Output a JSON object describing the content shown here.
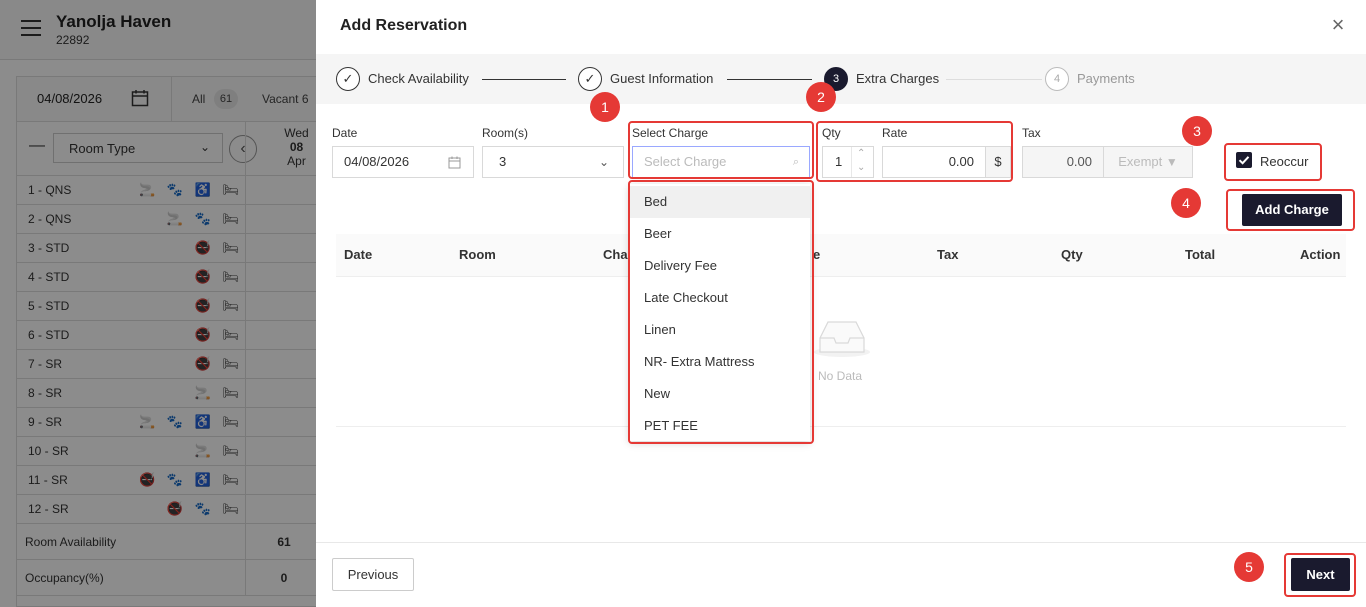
{
  "background": {
    "property_name": "Yanolja Haven",
    "property_id": "22892",
    "date": "04/08/2026",
    "filter_all": "All",
    "filter_all_count": "61",
    "filter_vacant": "Vacant",
    "filter_vacant_count": "6",
    "room_type_label": "Room Type",
    "day": {
      "weekday": "Wed",
      "date": "08",
      "month": "Apr"
    },
    "rooms": [
      {
        "name": "1 - QNS",
        "icons": "🚬 🐾 ♿ 🛏"
      },
      {
        "name": "2 - QNS",
        "icons": "🚬 🐾 🛏"
      },
      {
        "name": "3 - STD",
        "icons": "🚭 🛏"
      },
      {
        "name": "4 - STD",
        "icons": "🚭 🛏"
      },
      {
        "name": "5 - STD",
        "icons": "🚭 🛏"
      },
      {
        "name": "6 - STD",
        "icons": "🚭 🛏"
      },
      {
        "name": "7 - SR",
        "icons": "🚭 🛏"
      },
      {
        "name": "8 - SR",
        "icons": "🚬 🛏"
      },
      {
        "name": "9 - SR",
        "icons": "🚬 🐾 ♿ 🛏"
      },
      {
        "name": "10 - SR",
        "icons": "🚬 🛏"
      },
      {
        "name": "11 - SR",
        "icons": "🚭 🐾 ♿ 🛏"
      },
      {
        "name": "12 - SR",
        "icons": "🚭 🐾 🛏"
      }
    ],
    "room_availability_label": "Room Availability",
    "room_availability_value": "61",
    "occupancy_label": "Occupancy(%)",
    "occupancy_value": "0"
  },
  "drawer": {
    "title": "Add Reservation",
    "steps": [
      {
        "label": "Check Availability",
        "marker": "✓",
        "state": "done"
      },
      {
        "label": "Guest Information",
        "marker": "✓",
        "state": "done"
      },
      {
        "label": "Extra Charges",
        "marker": "3",
        "state": "active"
      },
      {
        "label": "Payments",
        "marker": "4",
        "state": "pending"
      }
    ],
    "form": {
      "date_label": "Date",
      "date_value": "04/08/2026",
      "rooms_label": "Room(s)",
      "rooms_value": "3",
      "charge_label": "Select Charge",
      "charge_placeholder": "Select Charge",
      "qty_label": "Qty",
      "qty_value": "1",
      "rate_label": "Rate",
      "rate_value": "0.00",
      "currency": "$",
      "tax_label": "Tax",
      "tax_value": "0.00",
      "exempt_label": "Exempt",
      "reoccur_label": "Reoccur",
      "reoccur_checked": true,
      "add_charge_label": "Add Charge"
    },
    "charge_options": [
      "Bed",
      "Beer",
      "Delivery Fee",
      "Late Checkout",
      "Linen",
      "NR- Extra Mattress",
      "New",
      "PET FEE"
    ],
    "table": {
      "columns": [
        "Date",
        "Room",
        "Charge",
        "Rate",
        "Tax",
        "Qty",
        "Total",
        "Action"
      ],
      "visible_columns": [
        "Date",
        "Room",
        "Charg",
        "e",
        "Tax",
        "Qty",
        "Total",
        "Action"
      ],
      "empty_text": "No Data"
    },
    "badges": [
      "1",
      "2",
      "3",
      "4",
      "5"
    ],
    "previous_label": "Previous",
    "next_label": "Next"
  },
  "colors": {
    "accent_dark": "#1a1a2e",
    "highlight_red": "#e53935"
  }
}
